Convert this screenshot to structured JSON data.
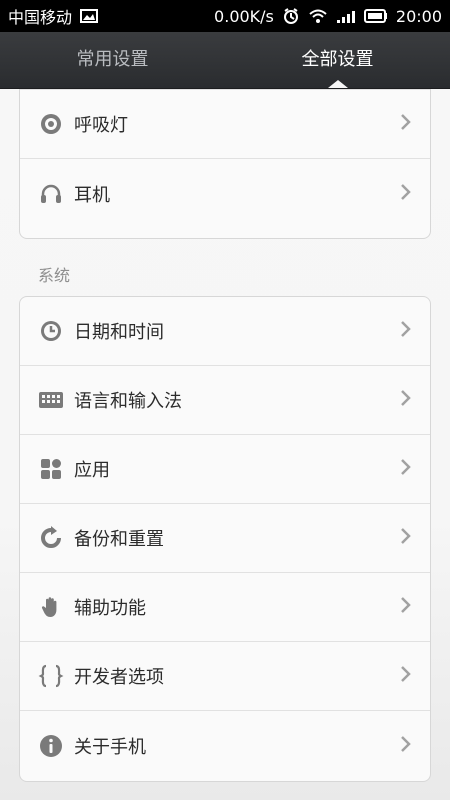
{
  "status_bar": {
    "carrier": "中国移动",
    "speed": "0.00K/s",
    "time": "20:00",
    "icons": [
      "image-icon",
      "alarm-icon",
      "wifi-icon",
      "signal-icon",
      "battery-icon"
    ]
  },
  "tabs": [
    {
      "label": "常用设置",
      "active": false
    },
    {
      "label": "全部设置",
      "active": true
    }
  ],
  "top_items": [
    {
      "label": "呼吸灯",
      "icon": "breathing-light-icon"
    },
    {
      "label": "耳机",
      "icon": "headphones-icon"
    }
  ],
  "system_section": {
    "title": "系统",
    "items": [
      {
        "label": "日期和时间",
        "icon": "clock-icon"
      },
      {
        "label": "语言和输入法",
        "icon": "keyboard-icon"
      },
      {
        "label": "应用",
        "icon": "apps-icon"
      },
      {
        "label": "备份和重置",
        "icon": "backup-reset-icon"
      },
      {
        "label": "辅助功能",
        "icon": "hand-icon"
      },
      {
        "label": "开发者选项",
        "icon": "braces-icon"
      },
      {
        "label": "关于手机",
        "icon": "info-icon"
      }
    ]
  },
  "colors": {
    "tab_bar": "#2f3134",
    "tab_active": "#ffffff",
    "tab_inactive": "#b9bcc0",
    "icon": "#7a7a7a",
    "chevron": "#a1a1a1"
  }
}
